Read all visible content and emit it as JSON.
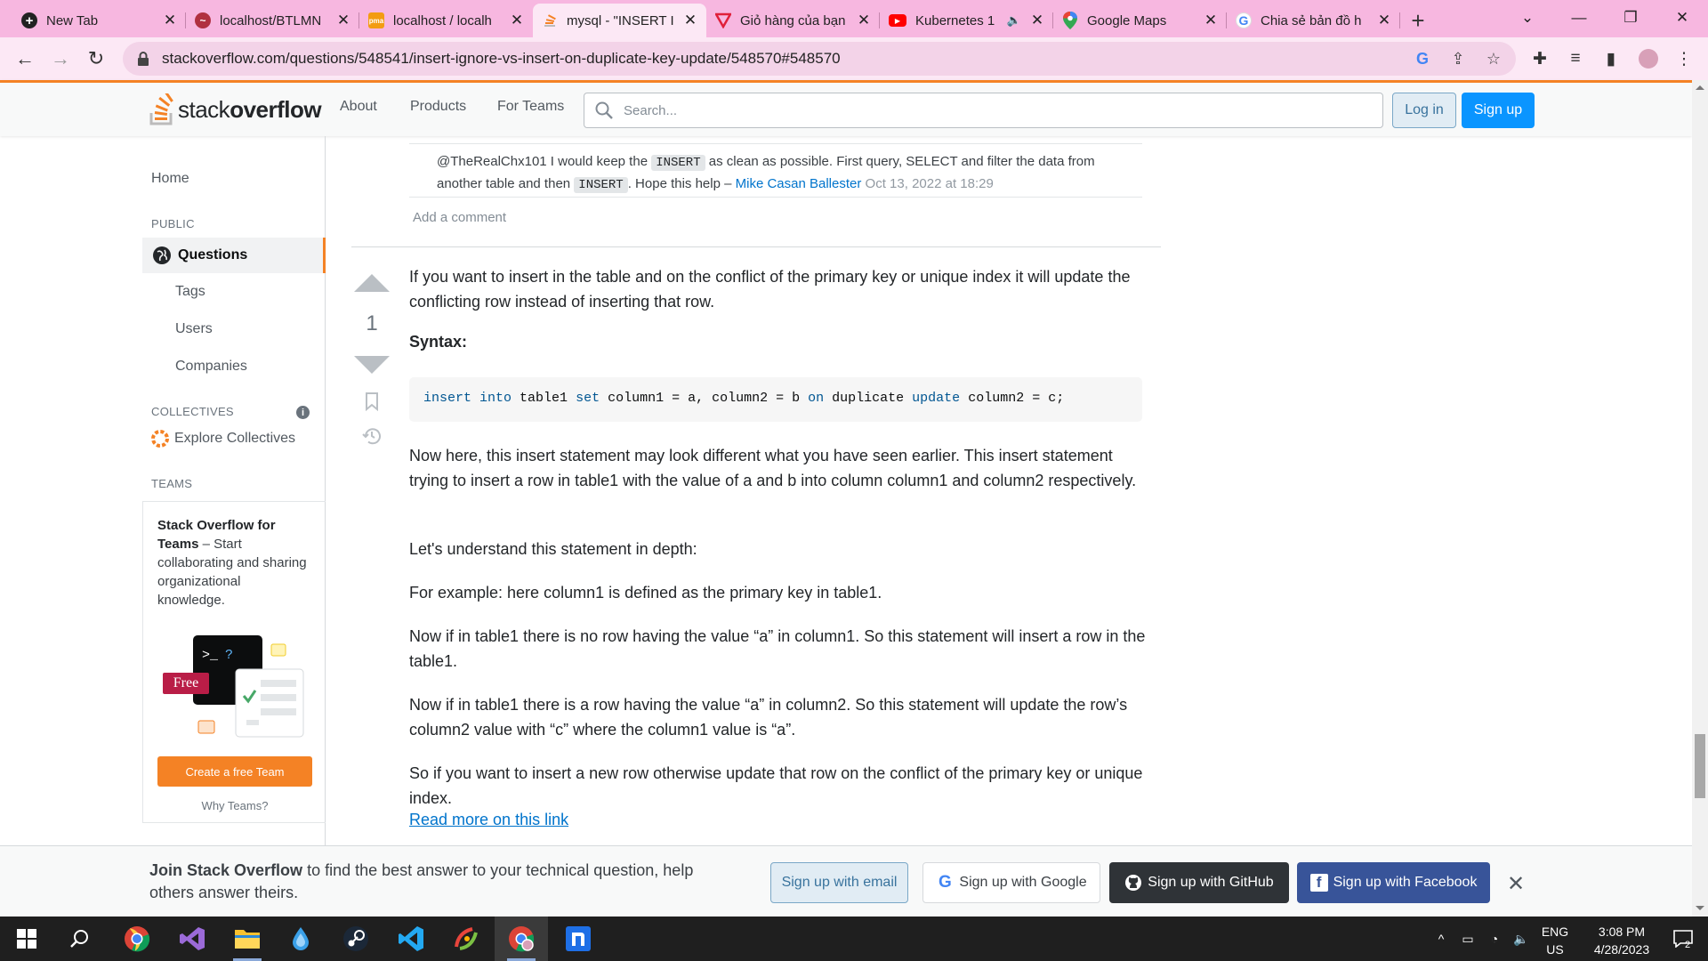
{
  "browser": {
    "tabs": [
      {
        "title": "New Tab",
        "icon": "plus-icon",
        "color": "#222222"
      },
      {
        "title": "localhost/BTLMN",
        "icon": "localhost-icon",
        "color": "#b03040"
      },
      {
        "title": "localhost / localh",
        "icon": "phpmyadmin-icon",
        "color": "#f39c12"
      },
      {
        "title": "mysql - \"INSERT I",
        "icon": "stackoverflow-icon",
        "color": "#f48225"
      },
      {
        "title": "Giỏ hàng của bạn",
        "icon": "shop-icon",
        "color": "#e0203a"
      },
      {
        "title": "Kubernetes 1",
        "icon": "youtube-icon",
        "color": "#ff0000"
      },
      {
        "title": "Google Maps",
        "icon": "maps-icon",
        "color": "#34a853"
      },
      {
        "title": "Chia sẻ bản đồ h",
        "icon": "google-icon",
        "color": "#4285f4"
      }
    ],
    "url": "stackoverflow.com/questions/548541/insert-ignore-vs-insert-on-duplicate-key-update/548570#548570"
  },
  "so_header": {
    "logo_prefix": "stack",
    "logo_bold": "overflow",
    "nav": [
      "About",
      "Products",
      "For Teams"
    ],
    "search_placeholder": "Search...",
    "login": "Log in",
    "signup": "Sign up"
  },
  "sidebar": {
    "home": "Home",
    "public_heading": "PUBLIC",
    "questions": "Questions",
    "tags": "Tags",
    "users": "Users",
    "companies": "Companies",
    "collectives_heading": "COLLECTIVES",
    "explore_collectives": "Explore Collectives",
    "teams_heading": "TEAMS",
    "teams_title": "Stack Overflow for Teams",
    "teams_desc": " – Start collaborating and sharing organizational knowledge.",
    "free_badge": "Free",
    "create_team": "Create a free Team",
    "why_teams": "Why Teams?"
  },
  "comment": {
    "part1": "@TheRealChx101 I would keep the ",
    "code1": "INSERT",
    "part2": " as clean as possible. First query, SELECT and filter the data from another table and then ",
    "code2": "INSERT",
    "part3": ". Hope this help – ",
    "author": "Mike Casan Ballester",
    "date": "Oct 13, 2022 at 18:29",
    "add_comment": "Add a comment"
  },
  "answer": {
    "votes": "1",
    "intro": "If you want to insert in the table and on the conflict of the primary key or unique index it will update the conflicting row instead of inserting that row.",
    "syntax_label": "Syntax:",
    "code_tokens": [
      {
        "t": "insert",
        "kw": true
      },
      {
        "t": " ",
        "kw": false
      },
      {
        "t": "into",
        "kw": true
      },
      {
        "t": " table1 ",
        "kw": false
      },
      {
        "t": "set",
        "kw": true
      },
      {
        "t": " column1 = a, column2 = b ",
        "kw": false
      },
      {
        "t": "on",
        "kw": true
      },
      {
        "t": " duplicate ",
        "kw": false
      },
      {
        "t": "update",
        "kw": true
      },
      {
        "t": " column2 = c;",
        "kw": false
      }
    ],
    "p1": "Now here, this insert statement may look different what you have seen earlier. This insert statement trying to insert a row in table1 with the value of a and b into column column1 and column2 respectively.",
    "p2": "Let's understand this statement in depth:",
    "p3": "For example: here column1 is defined as the primary key in table1.",
    "p4": "Now if in table1 there is no row having the value “a” in column1. So this statement will insert a row in the table1.",
    "p5": "Now if in table1 there is a row having the value “a” in column2. So this statement will update the row’s column2 value with “c” where the column1 value is “a”.",
    "p6": "So if you want to insert a new row otherwise update that row on the conflict of the primary key or unique index.",
    "read_more": "Read more on this link"
  },
  "banner": {
    "bold": "Join Stack Overflow",
    "text": " to find the best answer to your technical question, help others answer theirs.",
    "email": "Sign up with email",
    "google": "Sign up with Google",
    "github": "Sign up with GitHub",
    "facebook": "Sign up with Facebook"
  },
  "taskbar": {
    "lang1": "ENG",
    "lang2": "US",
    "time": "3:08 PM",
    "date": "4/28/2023",
    "notif_count": "2"
  }
}
